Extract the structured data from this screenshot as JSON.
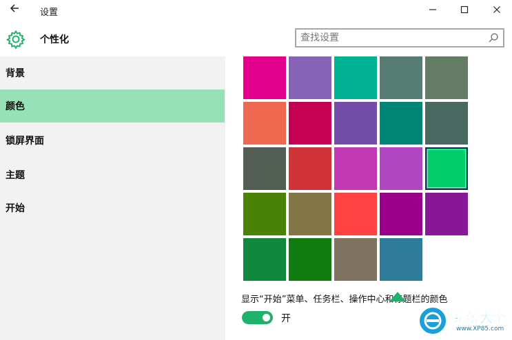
{
  "window": {
    "back_icon": "back-arrow-icon",
    "title": "设置",
    "controls": {
      "minimize": "—",
      "maximize": "☐",
      "close": "✕"
    }
  },
  "header": {
    "title": "个性化",
    "search_placeholder": "查找设置",
    "accent": "#1fb26b"
  },
  "sidebar": {
    "items": [
      {
        "label": "背景",
        "active": false
      },
      {
        "label": "颜色",
        "active": true
      },
      {
        "label": "锁屏界面",
        "active": false
      },
      {
        "label": "主题",
        "active": false
      },
      {
        "label": "开始",
        "active": false
      }
    ],
    "active_color": "#96e2b6"
  },
  "colors": {
    "rows": [
      [
        "#e3008c",
        "#8764b8",
        "#00b294",
        "#567c73",
        "#647c64"
      ],
      [
        "#ef6950",
        "#c30052",
        "#744da9",
        "#018574",
        "#486860"
      ],
      [
        "#525e54",
        "#d13438",
        "#c239b3",
        "#b146c2",
        "#00cc6a"
      ],
      [
        "#498205",
        "#847545",
        "#ff4343",
        "#9a0089",
        "#881798"
      ],
      [
        "#10893e",
        "#107c10",
        "#7e735f",
        "#2d7d9a"
      ]
    ],
    "selected": "#00cc6a"
  },
  "option": {
    "label": "显示“开始”菜单、任务栏、操作中心和标题栏的颜色",
    "toggle_state": "开"
  },
  "watermark": {
    "text": "系统大全",
    "url": "www.XP85.com"
  }
}
